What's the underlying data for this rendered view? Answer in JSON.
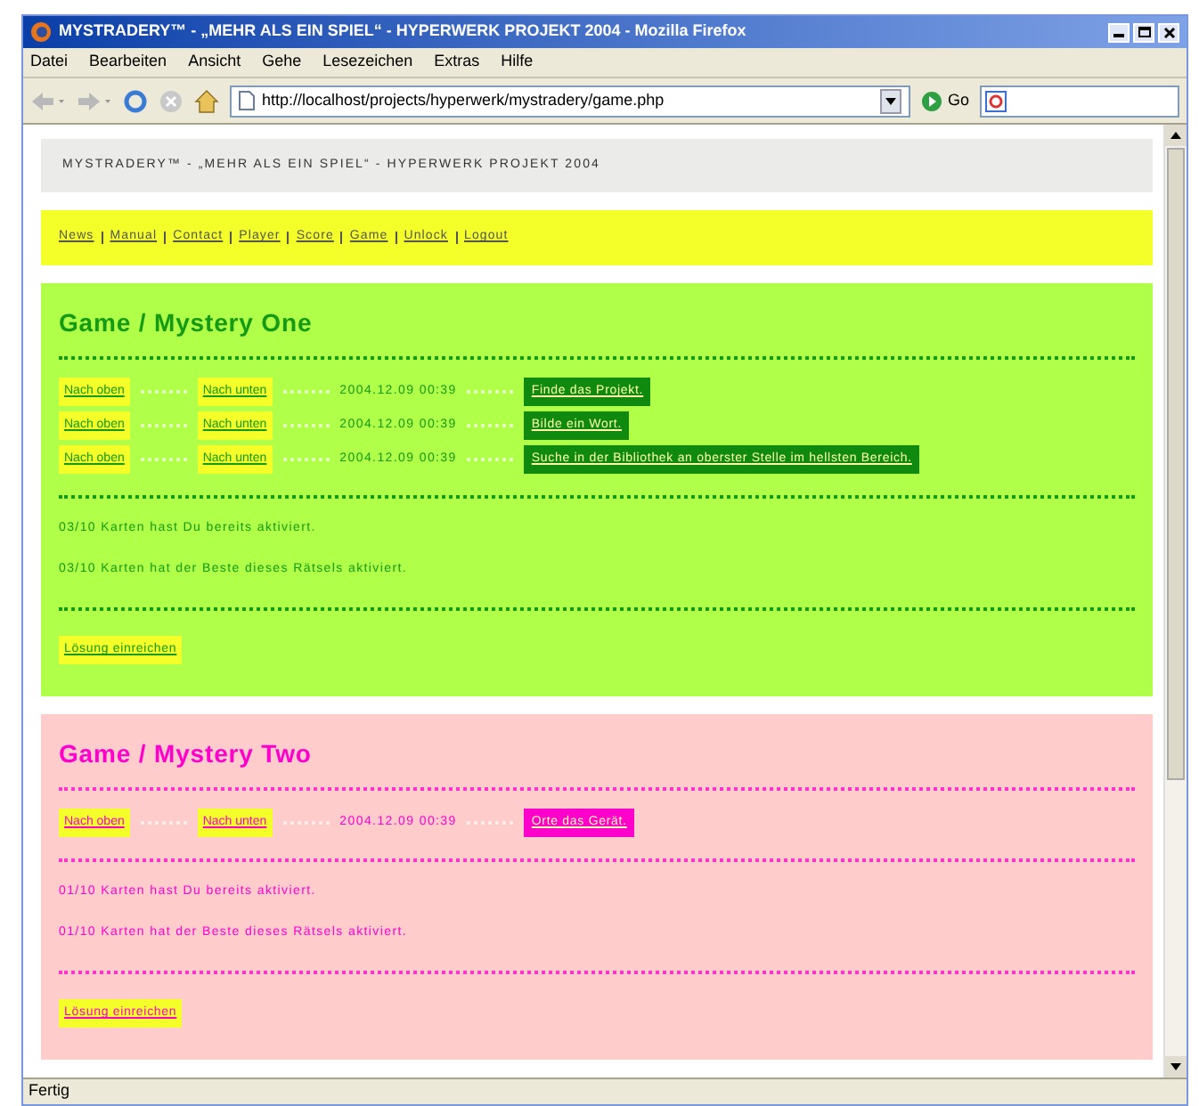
{
  "window": {
    "title": "MYSTRADERY™ - „MEHR ALS EIN SPIEL“ - HYPERWERK PROJEKT 2004 - Mozilla Firefox"
  },
  "menu": [
    "Datei",
    "Bearbeiten",
    "Ansicht",
    "Gehe",
    "Lesezeichen",
    "Extras",
    "Hilfe"
  ],
  "toolbar": {
    "url": "http://localhost/projects/hyperwerk/mystradery/game.php",
    "go": "Go"
  },
  "page": {
    "header": "MYSTRADERY™ - „MEHR ALS EIN SPIEL“ - HYPERWERK PROJEKT 2004",
    "nav": [
      "News",
      "Manual",
      "Contact",
      "Player",
      "Score",
      "Game",
      "Unlock",
      "Logout"
    ],
    "sections": [
      {
        "kind": "green",
        "title": "Game / Mystery One",
        "clues": [
          {
            "up": "Nach oben",
            "down": "Nach unten",
            "time": "2004.12.09 00:39",
            "text": "Finde das Projekt."
          },
          {
            "up": "Nach oben",
            "down": "Nach unten",
            "time": "2004.12.09 00:39",
            "text": "Bilde ein Wort."
          },
          {
            "up": "Nach oben",
            "down": "Nach unten",
            "time": "2004.12.09 00:39",
            "text": "Suche in der Bibliothek an oberster Stelle im hellsten Bereich."
          }
        ],
        "stats": [
          "03/10 Karten hast Du bereits aktiviert.",
          "03/10 Karten hat der Beste dieses Rätsels aktiviert."
        ],
        "submit": "Lösung einreichen"
      },
      {
        "kind": "pink",
        "title": "Game / Mystery Two",
        "clues": [
          {
            "up": "Nach oben",
            "down": "Nach unten",
            "time": "2004.12.09 00:39",
            "text": "Orte das Gerät."
          }
        ],
        "stats": [
          "01/10 Karten hast Du bereits aktiviert.",
          "01/10 Karten hat der Beste dieses Rätsels aktiviert."
        ],
        "submit": "Lösung einreichen"
      }
    ]
  },
  "status_bar": "Fertig"
}
